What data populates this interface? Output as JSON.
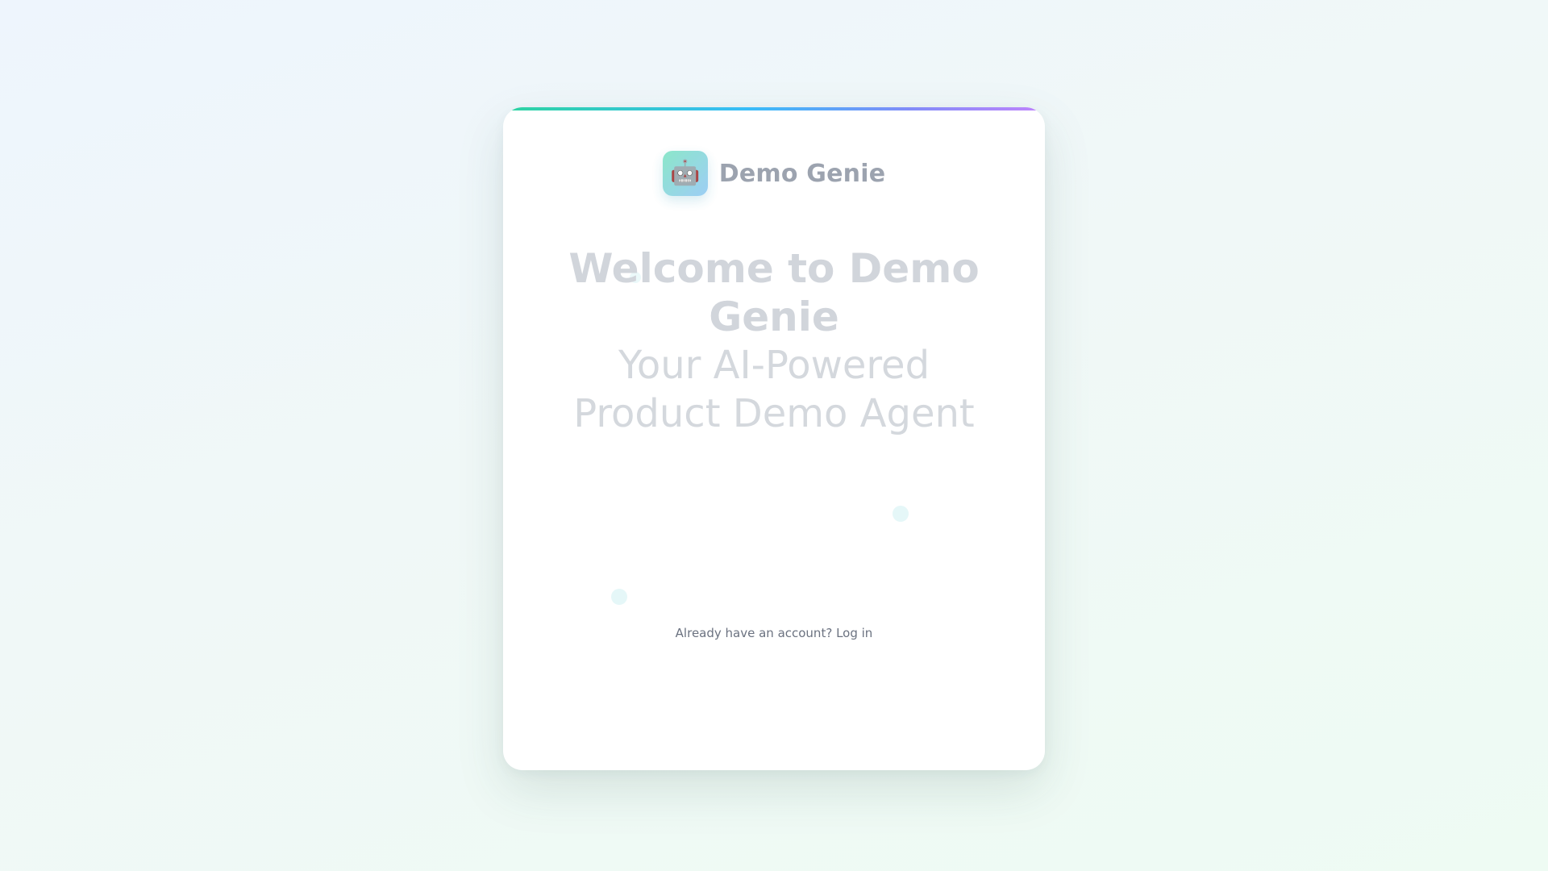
{
  "brand": {
    "logo_icon": "robot-icon",
    "logo_glyph": "🤖",
    "name": "Demo Genie"
  },
  "hero": {
    "title": "Welcome to Demo Genie",
    "subtitle": "Your AI-Powered Product Demo Agent"
  },
  "footer": {
    "login_prompt": "Already have an account?",
    "login_link": "Log in"
  },
  "colors": {
    "accent_gradient": [
      "#2dd4a0",
      "#38bdf8",
      "#818cf8",
      "#c084fc"
    ],
    "logo_gradient": [
      "#7fe4c4",
      "#93c9f4"
    ],
    "text_muted": "#6b7280"
  }
}
